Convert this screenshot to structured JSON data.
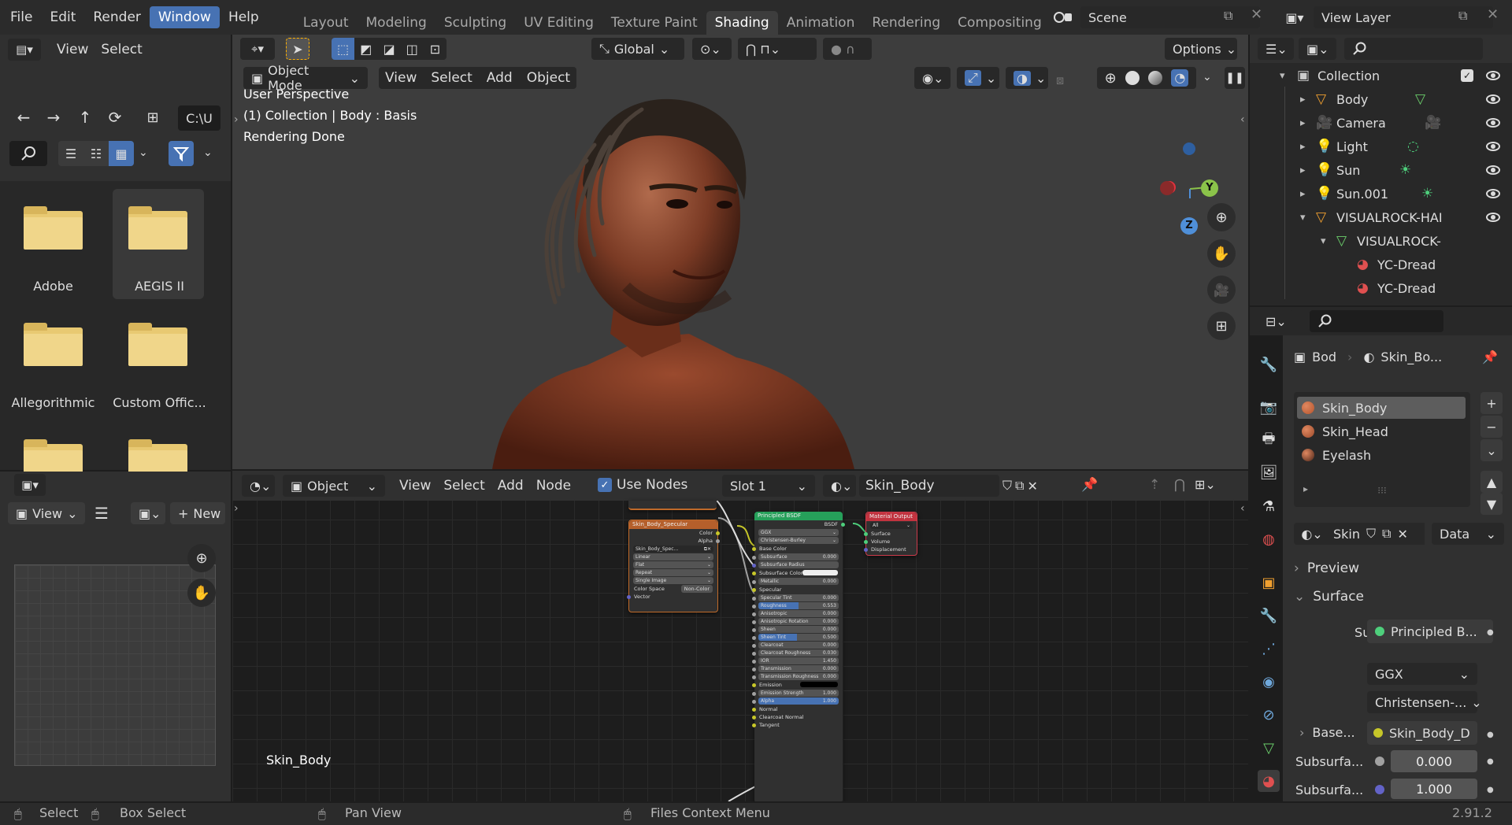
{
  "menu": [
    "File",
    "Edit",
    "Render",
    "Window",
    "Help"
  ],
  "menu_active": "Window",
  "workspaces": [
    "Layout",
    "Modeling",
    "Sculpting",
    "UV Editing",
    "Texture Paint",
    "Shading",
    "Animation",
    "Rendering",
    "Compositing"
  ],
  "workspace_active": "Shading",
  "scene": "Scene",
  "view_layer": "View Layer",
  "file_browser": {
    "menu": [
      "View",
      "Select"
    ],
    "path": "C:\\U",
    "folders": [
      "Adobe",
      "AEGIS II",
      "Allegorithmic",
      "Custom Offic...",
      "",
      ""
    ]
  },
  "viewport": {
    "mode": "Object Mode",
    "menu": [
      "View",
      "Select",
      "Add",
      "Object"
    ],
    "transform": "Global",
    "options": "Options",
    "overlay_lines": [
      "User Perspective",
      "(1) Collection | Body : Basis",
      "Rendering Done"
    ],
    "gizmo_y": "Y",
    "gizmo_z": "Z"
  },
  "image_editor": {
    "view": "View",
    "new": "New"
  },
  "node_editor": {
    "type": "Object",
    "menu": [
      "View",
      "Select",
      "Add",
      "Node"
    ],
    "use_nodes": "Use Nodes",
    "slot": "Slot 1",
    "material": "Skin_Body",
    "label": "Skin_Body",
    "tex_node": {
      "title": "Skin_Body_Specular",
      "outputs": [
        "Color",
        "Alpha"
      ],
      "image": "Skin_Body_Spec...",
      "fields": [
        "Linear",
        "Flat",
        "Repeat",
        "Single Image"
      ],
      "color_space_label": "Color Space",
      "color_space": "Non-Color",
      "input": "Vector"
    },
    "bsdf_node": {
      "title": "Principled BSDF",
      "output": "BSDF",
      "dist": "GGX",
      "sss": "Christensen-Burley",
      "rows": [
        {
          "label": "Base Color",
          "value": "",
          "kind": "sock"
        },
        {
          "label": "Subsurface",
          "value": "0.000",
          "kind": "field"
        },
        {
          "label": "Subsurface Radius",
          "value": "",
          "kind": "dd"
        },
        {
          "label": "Subsurface Color",
          "value": "",
          "kind": "color"
        },
        {
          "label": "Metallic",
          "value": "0.000",
          "kind": "field"
        },
        {
          "label": "Specular",
          "value": "",
          "kind": "sock"
        },
        {
          "label": "Specular Tint",
          "value": "0.000",
          "kind": "field"
        },
        {
          "label": "Roughness",
          "value": "0.553",
          "kind": "bar",
          "p": "50%"
        },
        {
          "label": "Anisotropic",
          "value": "0.000",
          "kind": "field"
        },
        {
          "label": "Anisotropic Rotation",
          "value": "0.000",
          "kind": "field"
        },
        {
          "label": "Sheen",
          "value": "0.000",
          "kind": "field"
        },
        {
          "label": "Sheen Tint",
          "value": "0.500",
          "kind": "bar",
          "p": "48%"
        },
        {
          "label": "Clearcoat",
          "value": "0.000",
          "kind": "field"
        },
        {
          "label": "Clearcoat Roughness",
          "value": "0.030",
          "kind": "field"
        },
        {
          "label": "IOR",
          "value": "1.450",
          "kind": "field"
        },
        {
          "label": "Transmission",
          "value": "0.000",
          "kind": "field"
        },
        {
          "label": "Transmission Roughness",
          "value": "0.000",
          "kind": "field"
        },
        {
          "label": "Emission",
          "value": "",
          "kind": "black"
        },
        {
          "label": "Emission Strength",
          "value": "1.000",
          "kind": "field"
        },
        {
          "label": "Alpha",
          "value": "1.000",
          "kind": "bar",
          "p": "100%"
        },
        {
          "label": "Normal",
          "value": "",
          "kind": "sock"
        },
        {
          "label": "Clearcoat Normal",
          "value": "",
          "kind": "sock"
        },
        {
          "label": "Tangent",
          "value": "",
          "kind": "sock"
        }
      ]
    },
    "output_node": {
      "title": "Material Output",
      "target": "All",
      "inputs": [
        "Surface",
        "Volume",
        "Displacement"
      ]
    }
  },
  "outliner": {
    "items": [
      {
        "label": "Collection",
        "indent": 0
      },
      {
        "label": "Body",
        "indent": 1
      },
      {
        "label": "Camera",
        "indent": 1
      },
      {
        "label": "Light",
        "indent": 1
      },
      {
        "label": "Sun",
        "indent": 1
      },
      {
        "label": "Sun.001",
        "indent": 1
      },
      {
        "label": "VISUALROCK-HAI",
        "indent": 1
      },
      {
        "label": "VISUALROCK-",
        "indent": 2
      },
      {
        "label": "YC-Dread",
        "indent": 3
      },
      {
        "label": "YC-Dread",
        "indent": 3
      }
    ]
  },
  "properties": {
    "breadcrumb_obj": "Bod",
    "breadcrumb_mat": "Skin_Bo...",
    "slots": [
      "Skin_Body",
      "Skin_Head",
      "Eyelash"
    ],
    "material_name": "Skin",
    "data_dd": "Data",
    "preview": "Preview",
    "surface_section": "Surface",
    "surface_label": "Surface",
    "surface_value": "Principled B...",
    "dist": "GGX",
    "sss": "Christensen-...",
    "base_label": "Base...",
    "base_value": "Skin_Body_D",
    "sub1_label": "Subsurfa...",
    "sub1_value": "0.000",
    "sub2_label": "Subsurfa...",
    "sub2_value": "1.000"
  },
  "status": {
    "select": "Select",
    "box_select": "Box Select",
    "pan": "Pan View",
    "context": "Files Context Menu",
    "version": "2.91.2"
  }
}
